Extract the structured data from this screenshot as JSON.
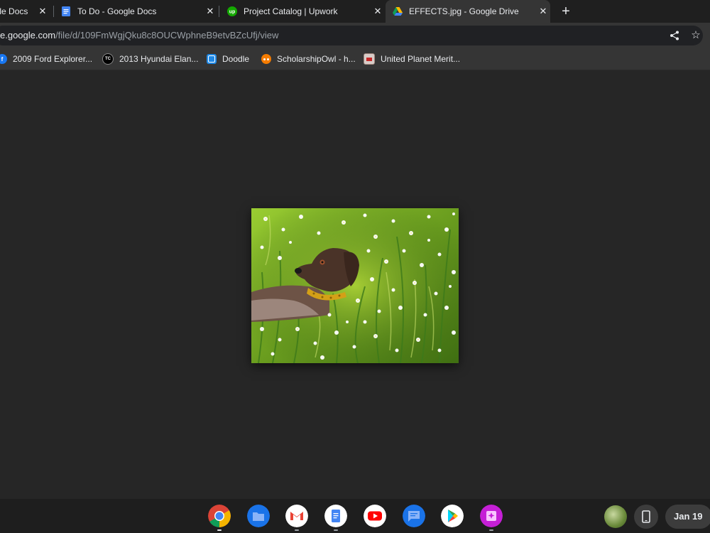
{
  "tabs": [
    {
      "title": "Google Docs",
      "favicon": "google-docs-icon"
    },
    {
      "title": "To Do - Google Docs",
      "favicon": "google-docs-icon"
    },
    {
      "title": "Project Catalog | Upwork",
      "favicon": "upwork-icon"
    },
    {
      "title": "EFFECTS.jpg - Google Drive",
      "favicon": "google-drive-icon",
      "active": true
    }
  ],
  "toolbar": {
    "url_host": "e.google.com",
    "url_path": "/file/d/109FmWgjQku8c8OUCWphneB9etvBZcUfj/view",
    "share_icon": "share-icon",
    "star_icon": "star-icon"
  },
  "bookmarks": [
    {
      "label": "2009 Ford Explorer...",
      "icon": "facebook-icon",
      "badge": "f"
    },
    {
      "label": "2013 Hyundai Elan...",
      "icon": "tc-icon",
      "badge": "TC"
    },
    {
      "label": "Doodle",
      "icon": "doodle-icon",
      "badge": ""
    },
    {
      "label": "ScholarshipOwl - h...",
      "icon": "owl-icon",
      "badge": ""
    },
    {
      "label": "United Planet Merit...",
      "icon": "unitedplanet-icon",
      "badge": ""
    }
  ],
  "image": {
    "file_name": "EFFECTS.jpg",
    "subject": "painting of a brown dog with a yellow collar in green grass with white flowers"
  },
  "shelf": {
    "apps": [
      "chrome-icon",
      "files-icon",
      "gmail-icon",
      "docs-icon",
      "youtube-icon",
      "messages-icon",
      "play-store-icon",
      "gallery-icon"
    ],
    "date": "Jan 19"
  },
  "colors": {
    "background": "#262626",
    "tabstrip": "#1f1f1f",
    "toolbar": "#353535",
    "omnibox": "#202124",
    "shelf": "#1e1e1e"
  }
}
